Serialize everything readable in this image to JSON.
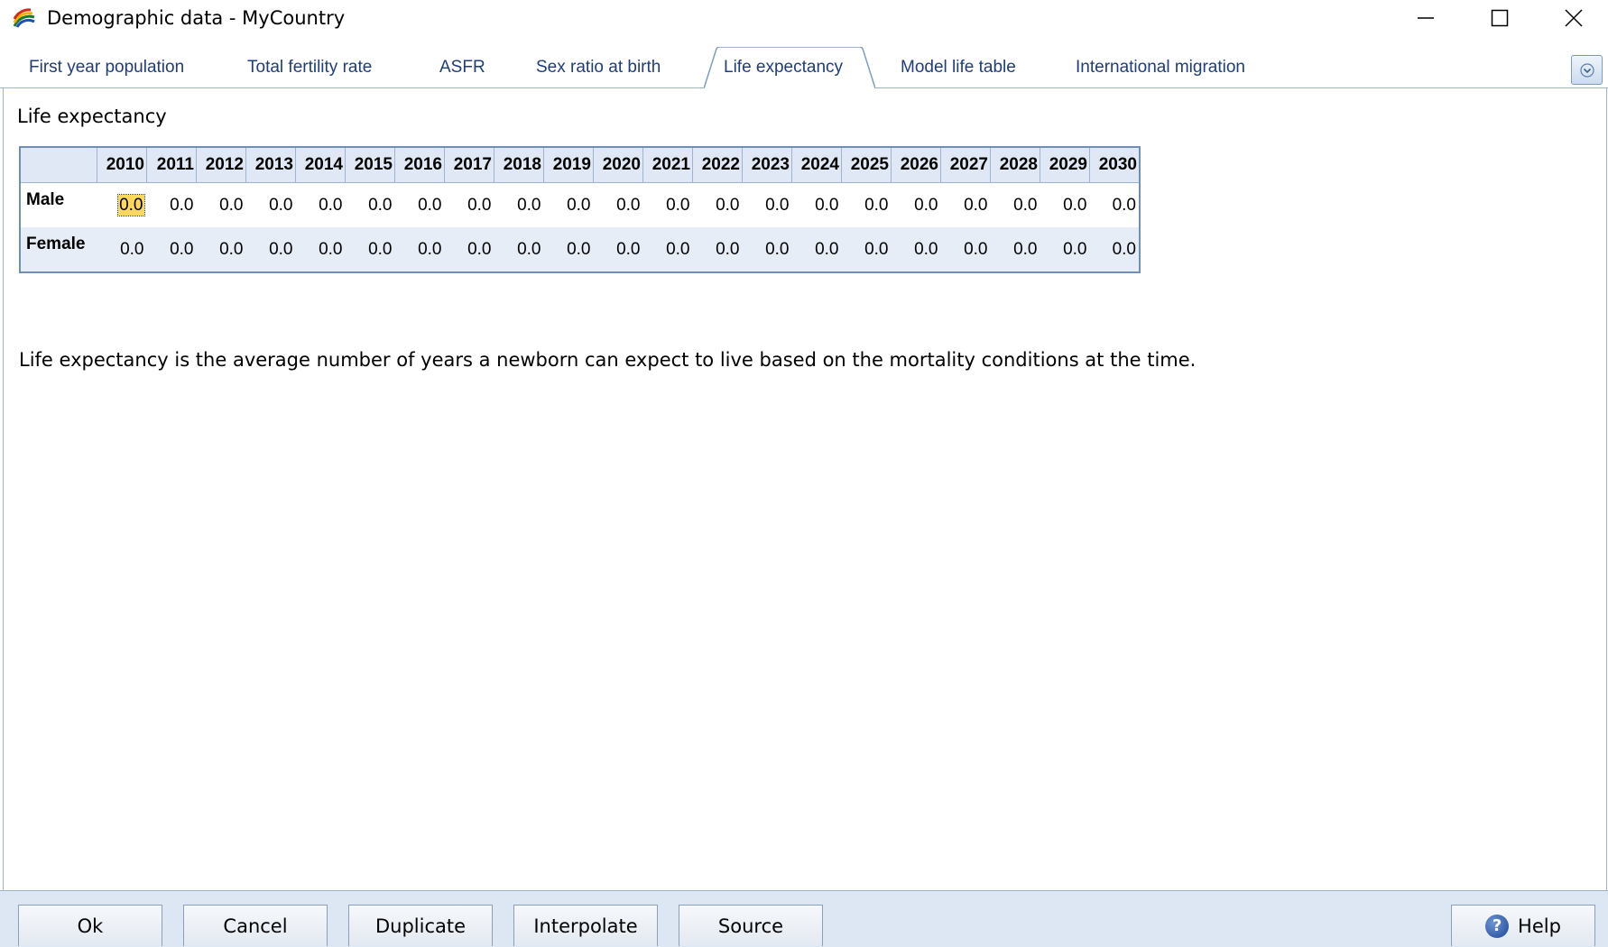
{
  "window": {
    "title": "Demographic data - MyCountry",
    "app_icon": "rainbow-icon",
    "controls": [
      "minimize-icon",
      "maximize-icon",
      "close-icon"
    ]
  },
  "tabs": [
    {
      "label": "First year population",
      "active": false
    },
    {
      "label": "Total fertility rate",
      "active": false
    },
    {
      "label": "ASFR",
      "active": false
    },
    {
      "label": "Sex ratio at birth",
      "active": false
    },
    {
      "label": "Life expectancy",
      "active": true
    },
    {
      "label": "Model life table",
      "active": false
    },
    {
      "label": "International migration",
      "active": false
    }
  ],
  "tab_overflow_icon": "chevron-down-icon",
  "section_title": "Life expectancy",
  "grid": {
    "years": [
      "2010",
      "2011",
      "2012",
      "2013",
      "2014",
      "2015",
      "2016",
      "2017",
      "2018",
      "2019",
      "2020",
      "2021",
      "2022",
      "2023",
      "2024",
      "2025",
      "2026",
      "2027",
      "2028",
      "2029",
      "2030"
    ],
    "rows": [
      {
        "label": "Male",
        "values": [
          "0.0",
          "0.0",
          "0.0",
          "0.0",
          "0.0",
          "0.0",
          "0.0",
          "0.0",
          "0.0",
          "0.0",
          "0.0",
          "0.0",
          "0.0",
          "0.0",
          "0.0",
          "0.0",
          "0.0",
          "0.0",
          "0.0",
          "0.0",
          "0.0"
        ]
      },
      {
        "label": "Female",
        "values": [
          "0.0",
          "0.0",
          "0.0",
          "0.0",
          "0.0",
          "0.0",
          "0.0",
          "0.0",
          "0.0",
          "0.0",
          "0.0",
          "0.0",
          "0.0",
          "0.0",
          "0.0",
          "0.0",
          "0.0",
          "0.0",
          "0.0",
          "0.0",
          "0.0"
        ]
      }
    ],
    "selected_cell": {
      "row": 0,
      "col": 0
    },
    "selected_color": "#ffd75a"
  },
  "description": "Life expectancy is the average number of years a newborn can expect to live based on the mortality conditions at the time.",
  "buttons": {
    "ok": "Ok",
    "cancel": "Cancel",
    "duplicate": "Duplicate",
    "interpolate": "Interpolate",
    "source": "Source",
    "help": "Help"
  },
  "colors": {
    "tab_text": "#1f3d7a",
    "header_bg": "#dfe8f4",
    "alt_row_bg": "#e7edf6",
    "button_bar_bg": "#dde7f3"
  }
}
